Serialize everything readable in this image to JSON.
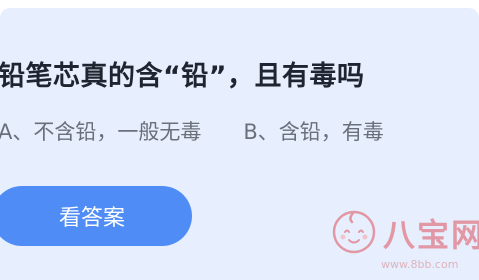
{
  "question": {
    "text": "铅笔芯真的含“铅”，且有毒吗"
  },
  "options": {
    "a": "A、不含铅，一般无毒",
    "b": "B、含铅，有毒"
  },
  "answer_button": {
    "label": "看答案"
  },
  "watermark": {
    "name": "八宝网",
    "url": "www.8bb.com",
    "icon": "baby-face-logo-icon",
    "color": "#e07b86"
  },
  "colors": {
    "card_background": "#e7effe",
    "button": "#4f8cf6",
    "question_text": "#1e2530",
    "option_text": "#6a707a"
  }
}
